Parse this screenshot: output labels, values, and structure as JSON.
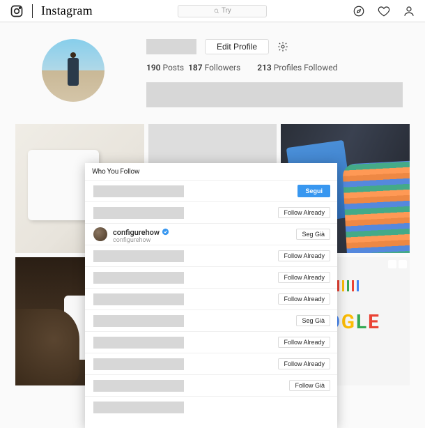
{
  "topbar": {
    "brand": "Instagram",
    "search_placeholder": "Try"
  },
  "profile": {
    "edit_label": "Edit Profile",
    "posts_count": "190",
    "posts_label": "Posts",
    "followers_count": "187",
    "followers_label": "Followers",
    "following_count": "213",
    "following_label": "Profiles Followed"
  },
  "modal": {
    "title": "Who You Follow",
    "rows": [
      {
        "button": "Segui",
        "primary": true
      },
      {
        "button": "Follow Already"
      },
      {
        "name": "configurehow",
        "sub": "configurehow",
        "verified": true,
        "avatar": true,
        "button": "Seg Già"
      },
      {
        "button": "Follow Already"
      },
      {
        "button": "Follow Already"
      },
      {
        "button": "Follow Already"
      },
      {
        "button": "Seg Già"
      },
      {
        "button": "Follow Already"
      },
      {
        "button": "Follow Already"
      },
      {
        "button": "Follow Già"
      },
      {
        "button": ""
      }
    ]
  }
}
